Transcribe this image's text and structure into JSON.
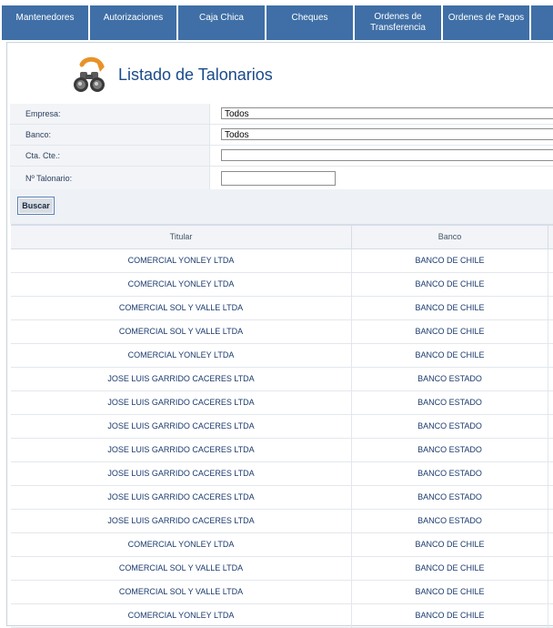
{
  "nav": {
    "items": [
      {
        "label": "Mantenedores"
      },
      {
        "label": "Autorizaciones"
      },
      {
        "label": "Caja Chica"
      },
      {
        "label": "Cheques"
      },
      {
        "label": "Ordenes de Transferencia"
      },
      {
        "label": "Ordenes de Pagos"
      },
      {
        "label": ""
      }
    ]
  },
  "page": {
    "title": "Listado de Talonarios",
    "icon": "binoculars-icon"
  },
  "filters": {
    "empresa_label": "Empresa:",
    "empresa_value": "Todos",
    "banco_label": "Banco:",
    "banco_value": "Todos",
    "cta_label": "Cta. Cte.:",
    "cta_value": "",
    "talonario_label": "Nº Talonario:",
    "talonario_value": "",
    "buscar_label": "Buscar"
  },
  "table": {
    "headers": {
      "titular": "Titular",
      "banco": "Banco"
    },
    "rows": [
      {
        "titular": "COMERCIAL YONLEY LTDA",
        "banco": "BANCO DE CHILE"
      },
      {
        "titular": "COMERCIAL YONLEY LTDA",
        "banco": "BANCO DE CHILE"
      },
      {
        "titular": "COMERCIAL SOL Y VALLE LTDA",
        "banco": "BANCO DE CHILE"
      },
      {
        "titular": "COMERCIAL SOL Y VALLE LTDA",
        "banco": "BANCO DE CHILE"
      },
      {
        "titular": "COMERCIAL YONLEY LTDA",
        "banco": "BANCO DE CHILE"
      },
      {
        "titular": "JOSE LUIS GARRIDO CACERES LTDA",
        "banco": "BANCO ESTADO"
      },
      {
        "titular": "JOSE LUIS GARRIDO CACERES LTDA",
        "banco": "BANCO ESTADO"
      },
      {
        "titular": "JOSE LUIS GARRIDO CACERES LTDA",
        "banco": "BANCO ESTADO"
      },
      {
        "titular": "JOSE LUIS GARRIDO CACERES LTDA",
        "banco": "BANCO ESTADO"
      },
      {
        "titular": "JOSE LUIS GARRIDO CACERES LTDA",
        "banco": "BANCO ESTADO"
      },
      {
        "titular": "JOSE LUIS GARRIDO CACERES LTDA",
        "banco": "BANCO ESTADO"
      },
      {
        "titular": "JOSE LUIS GARRIDO CACERES LTDA",
        "banco": "BANCO ESTADO"
      },
      {
        "titular": "COMERCIAL YONLEY LTDA",
        "banco": "BANCO DE CHILE"
      },
      {
        "titular": "COMERCIAL SOL Y VALLE LTDA",
        "banco": "BANCO DE CHILE"
      },
      {
        "titular": "COMERCIAL SOL Y VALLE LTDA",
        "banco": "BANCO DE CHILE"
      },
      {
        "titular": "COMERCIAL YONLEY LTDA",
        "banco": "BANCO DE CHILE"
      }
    ]
  },
  "colors": {
    "nav_bg": "#3f6fa6",
    "title": "#1a4a8a",
    "text": "#1a3a6e"
  }
}
